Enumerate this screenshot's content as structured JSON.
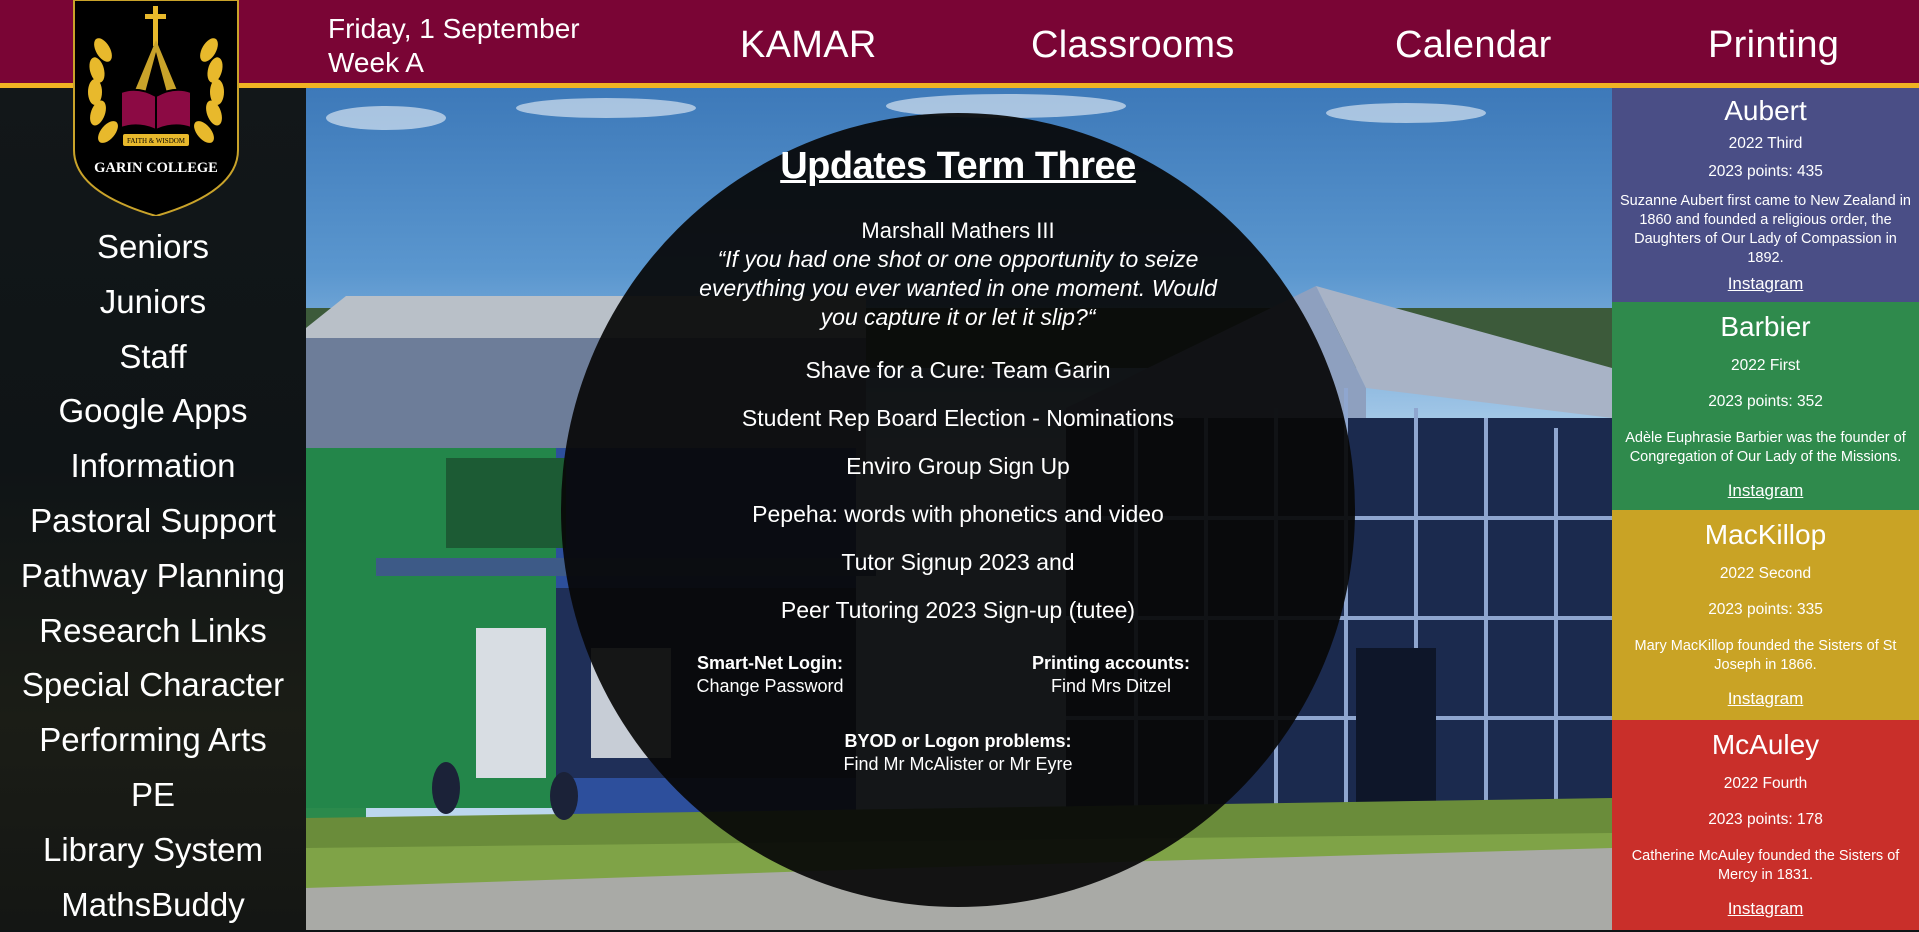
{
  "header": {
    "date": "Friday, 1 September",
    "week": "Week A",
    "nav": [
      "KAMAR",
      "Classrooms",
      "Calendar",
      "Printing"
    ]
  },
  "logo": {
    "motto": "FAITH & WISDOM",
    "name": "GARIN COLLEGE"
  },
  "sidebar": {
    "items": [
      "Seniors",
      "Juniors",
      "Staff",
      "Google Apps",
      "Information",
      "Pastoral Support",
      "Pathway Planning",
      "Research Links",
      "Special Character",
      "Performing Arts",
      "PE",
      "Library System",
      "MathsBuddy"
    ]
  },
  "updates": {
    "title": "Updates Term Three",
    "quote_author": "Marshall Mathers III",
    "quote": "“If you had one shot or one opportunity to seize everything you ever wanted in one moment. Would you capture it or let it slip?“",
    "links": [
      "Shave for a Cure: Team Garin",
      "Student Rep Board Election - Nominations",
      "Enviro Group Sign Up",
      "Pepeha: words with phonetics and video",
      "Tutor Signup 2023 and",
      "Peer Tutoring 2023 Sign-up (tutee)"
    ],
    "smartnet_label": "Smart-Net Login:",
    "smartnet_value": "Change Password",
    "printing_label": "Printing accounts:",
    "printing_value": "Find Mrs Ditzel",
    "byod_label": "BYOD or Logon problems:",
    "byod_value": "Find Mr McAlister or Mr Eyre"
  },
  "houses": [
    {
      "name": "Aubert",
      "rank": "2022 Third",
      "points": "2023 points: 435",
      "desc": "Suzanne Aubert first came to New Zealand in 1860 and founded a religious order, the Daughters of Our Lady of Compassion in 1892.",
      "link": "Instagram",
      "color": "#4a4e86"
    },
    {
      "name": "Barbier",
      "rank": "2022 First",
      "points": "2023 points: 352",
      "desc": "Adèle Euphrasie Barbier was the founder of Congregation of Our Lady of the Missions.",
      "link": "Instagram",
      "color": "#2f8a4c"
    },
    {
      "name": "MacKillop",
      "rank": "2022 Second",
      "points": "2023 points: 335",
      "desc": "Mary MacKillop founded the Sisters of St Joseph in 1866.",
      "link": "Instagram",
      "color": "#c9a325"
    },
    {
      "name": "McAuley",
      "rank": "2022 Fourth",
      "points": "2023 points: 178",
      "desc": "Catherine McAuley founded the Sisters of Mercy in 1831.",
      "link": "Instagram",
      "color": "#c92f2a"
    }
  ],
  "colors": {
    "header": "#7a0535",
    "accent": "#f0b323",
    "sidebar": "#0f1416"
  }
}
